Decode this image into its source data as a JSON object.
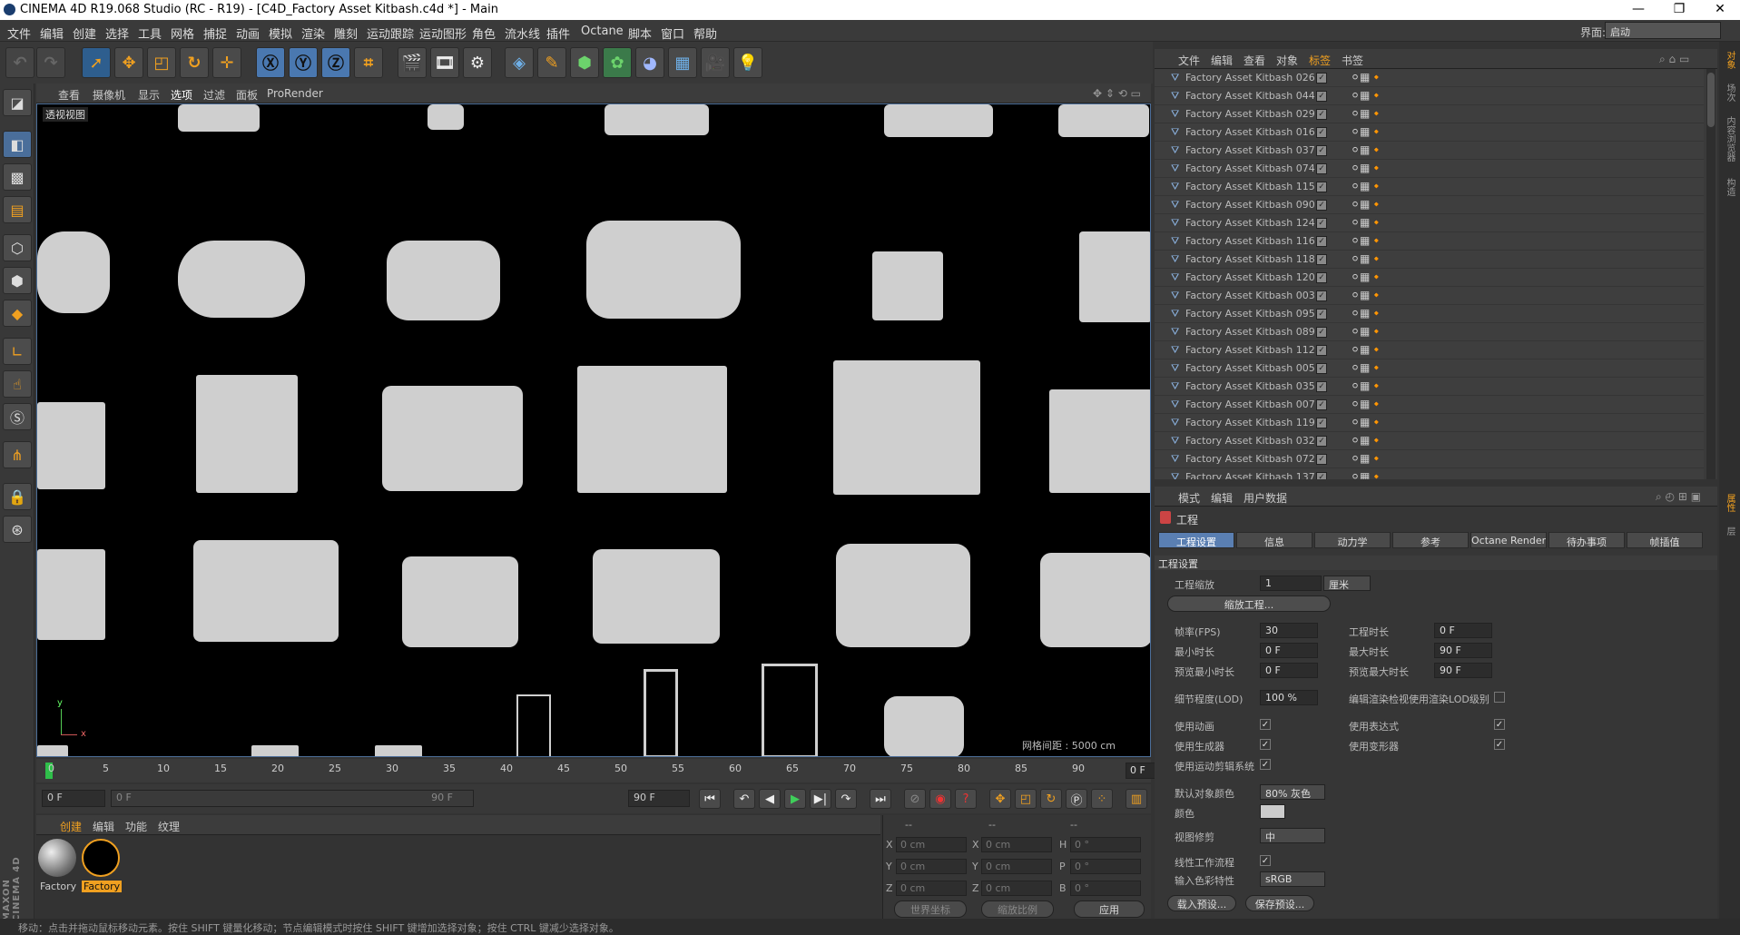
{
  "window": {
    "title": "CINEMA 4D R19.068 Studio (RC - R19) - [C4D_Factory Asset Kitbash.c4d *] - Main",
    "min": "—",
    "max": "❐",
    "close": "✕"
  },
  "menu": [
    "文件",
    "编辑",
    "创建",
    "选择",
    "工具",
    "网格",
    "捕捉",
    "动画",
    "模拟",
    "渲染",
    "雕刻",
    "运动跟踪",
    "运动图形",
    "角色",
    "流水线",
    "插件",
    "Octane",
    "脚本",
    "窗口",
    "帮助"
  ],
  "layout": {
    "label": "界面:",
    "value": "启动"
  },
  "viewport": {
    "menu": [
      "查看",
      "摄像机",
      "显示",
      "选项",
      "过滤",
      "面板",
      "ProRender"
    ],
    "label": "透视视图",
    "grid": "网格间距 : 5000 cm"
  },
  "timeline": {
    "ticks": [
      "0",
      "5",
      "10",
      "15",
      "20",
      "25",
      "30",
      "35",
      "40",
      "45",
      "50",
      "55",
      "60",
      "65",
      "70",
      "75",
      "80",
      "85",
      "90"
    ],
    "current": "0 F",
    "start": "0 F",
    "range_start": "0 F",
    "range_end": "90 F",
    "end": "90 F"
  },
  "materials": {
    "menu": [
      "创建",
      "编辑",
      "功能",
      "纹理"
    ],
    "items": [
      {
        "label": "Factory"
      },
      {
        "label": "Factory"
      }
    ]
  },
  "coords": {
    "headers": [
      "--",
      "--",
      "--"
    ],
    "rows": [
      {
        "a": "X",
        "av": "0 cm",
        "b": "X",
        "bv": "0 cm",
        "c": "H",
        "cv": "0 °"
      },
      {
        "a": "Y",
        "av": "0 cm",
        "b": "Y",
        "bv": "0 cm",
        "c": "P",
        "cv": "0 °"
      },
      {
        "a": "Z",
        "av": "0 cm",
        "b": "Z",
        "bv": "0 cm",
        "c": "B",
        "cv": "0 °"
      }
    ],
    "mode1": "世界坐标",
    "mode2": "缩放比例",
    "apply": "应用"
  },
  "objects": {
    "menu": [
      "文件",
      "编辑",
      "查看",
      "对象",
      "标签",
      "书签"
    ],
    "items": [
      "Factory Asset Kitbash 026",
      "Factory Asset Kitbash 044",
      "Factory Asset Kitbash 029",
      "Factory Asset Kitbash 016",
      "Factory Asset Kitbash 037",
      "Factory Asset Kitbash 074",
      "Factory Asset Kitbash 115",
      "Factory Asset Kitbash 090",
      "Factory Asset Kitbash 124",
      "Factory Asset Kitbash 116",
      "Factory Asset Kitbash 118",
      "Factory Asset Kitbash 120",
      "Factory Asset Kitbash 003",
      "Factory Asset Kitbash 095",
      "Factory Asset Kitbash 089",
      "Factory Asset Kitbash 112",
      "Factory Asset Kitbash 005",
      "Factory Asset Kitbash 035",
      "Factory Asset Kitbash 007",
      "Factory Asset Kitbash 119",
      "Factory Asset Kitbash 032",
      "Factory Asset Kitbash 072",
      "Factory Asset Kitbash 137"
    ]
  },
  "attributes": {
    "menu": [
      "模式",
      "编辑",
      "用户数据"
    ],
    "title": "工程",
    "tabs": [
      "工程设置",
      "信息",
      "动力学",
      "参考",
      "Octane Render",
      "待办事项",
      "帧插值"
    ],
    "section": "工程设置",
    "scale_label": "工程缩放",
    "scale_value": "1",
    "scale_unit": "厘米",
    "scale_btn": "缩放工程...",
    "fps_label": "帧率(FPS)",
    "fps_value": "30",
    "len_label": "工程时长",
    "len_value": "0 F",
    "min_label": "最小时长",
    "min_value": "0 F",
    "max_label": "最大时长",
    "max_value": "90 F",
    "pmin_label": "预览最小时长",
    "pmin_value": "0 F",
    "pmax_label": "预览最大时长",
    "pmax_value": "90 F",
    "lod_label": "细节程度(LOD)",
    "lod_value": "100 %",
    "lod_check_label": "编辑渲染检视使用渲染LOD级别",
    "anim_label": "使用动画",
    "expr_label": "使用表达式",
    "gen_label": "使用生成器",
    "deform_label": "使用变形器",
    "motion_label": "使用运动剪辑系统",
    "objcolor_label": "默认对象颜色",
    "objcolor_value": "80% 灰色",
    "color_label": "颜色",
    "clip_label": "视图修剪",
    "clip_value": "中",
    "linear_label": "线性工作流程",
    "profile_label": "输入色彩特性",
    "profile_value": "sRGB",
    "load_btn": "载入预设...",
    "save_btn": "保存预设..."
  },
  "status": "移动：点击并拖动鼠标移动元素。按住 SHIFT 键量化移动；节点编辑模式时按住 SHIFT 键增加选择对象；按住 CTRL 键减少选择对象。",
  "brand": "MAXON CINEMA 4D",
  "right_tabs": [
    "对象",
    "场次",
    "内容浏览器",
    "构造",
    "属性",
    "层"
  ]
}
